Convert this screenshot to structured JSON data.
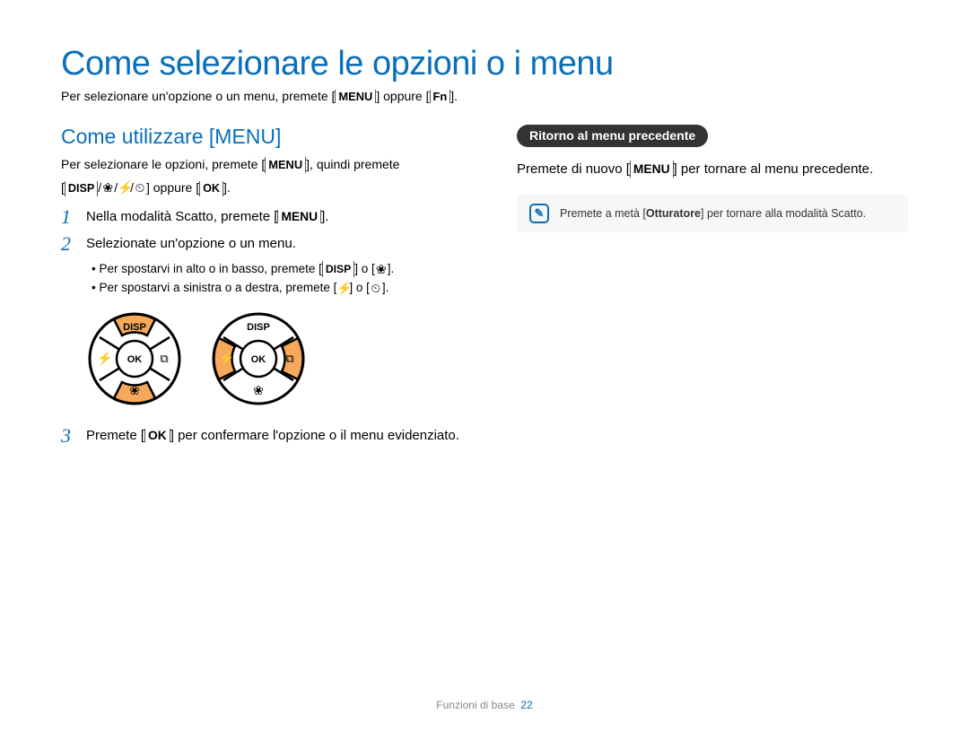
{
  "title": "Come selezionare le opzioni o i menu",
  "intro": {
    "pre": "Per selezionare un'opzione o un menu, premete [",
    "k1": "MENU",
    "mid": "] oppure [",
    "k2": "Fn",
    "post": "]."
  },
  "left": {
    "heading": "Come utilizzare [MENU]",
    "p1_a": "Per selezionare le opzioni, premete [",
    "p1_k": "MENU",
    "p1_b": "], quindi premete",
    "p2_a": "[",
    "p2_k1": "DISP",
    "p2_mid": "] oppure [",
    "p2_k2": "OK",
    "p2_b": "].",
    "steps": [
      {
        "num": "1",
        "pre": "Nella modalità Scatto, premete [",
        "key": "MENU",
        "post": "]."
      },
      {
        "num": "2",
        "pre": "Selezionate un'opzione o un menu.",
        "key": "",
        "post": ""
      }
    ],
    "bullets": [
      {
        "pre": "Per spostarvi in alto o in basso, premete [",
        "k1": "DISP",
        "mid": "] o [",
        "g2": "❀",
        "post": "]."
      },
      {
        "pre": "Per spostarvi a sinistra o a destra, premete [",
        "g1": "⚡",
        "mid": "] o [",
        "g2": "⏲",
        "post": "]."
      }
    ],
    "step3": {
      "num": "3",
      "pre": "Premete [",
      "key": "OK",
      "post": "] per confermare l'opzione o il menu evidenziato."
    }
  },
  "dials": {
    "disp": "DISP",
    "ok": "OK",
    "highlight_color": "#f6a95a"
  },
  "right": {
    "pill": "Ritorno al menu precedente",
    "p_pre": "Premete di nuovo [",
    "p_key": "MENU",
    "p_post": "] per tornare al menu precedente.",
    "note_pre": "Premete a metà [",
    "note_key": "Otturatore",
    "note_post": "] per tornare alla modalità Scatto."
  },
  "footer": {
    "label": "Funzioni di base",
    "page": "22"
  }
}
